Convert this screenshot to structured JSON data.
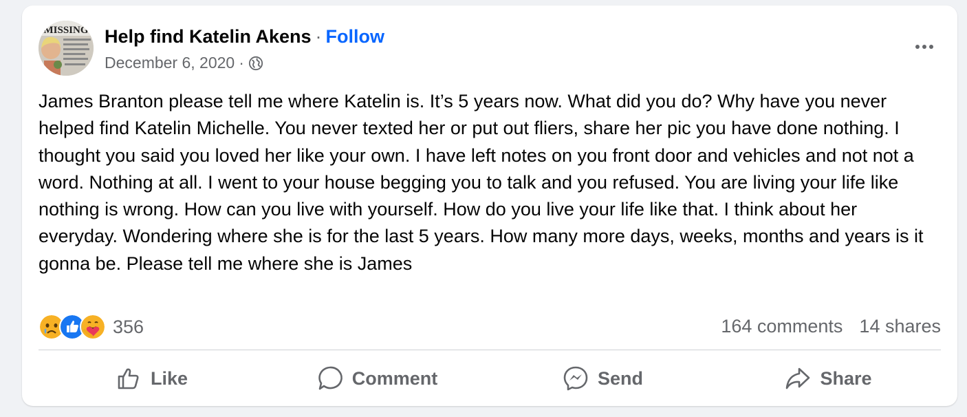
{
  "post": {
    "page_name": "Help find Katelin Akens",
    "separator": "·",
    "follow_label": "Follow",
    "date": "December 6, 2020",
    "privacy_icon": "globe-icon",
    "body": "James Branton please tell me where Katelin  is. It’s 5 years now. What did you do? Why have you never helped find Katelin Michelle. You never texted her or put out fliers, share her pic you have done nothing. I thought you said you loved her like your own. I have left notes on you front door and vehicles and not not a word. Nothing at all. I went to your house begging you to talk and you refused. You are living your life like nothing is wrong. How can you live with yourself. How do you live your life like that. I think about her everyday. Wondering where she is for the last 5 years. How many more days, weeks, months and years is it gonna be. Please tell me where she is James",
    "avatar_text": "MISSING"
  },
  "reactions": {
    "icons": [
      "sad-icon",
      "like-icon",
      "care-icon"
    ],
    "count": "356",
    "comments": "164 comments",
    "shares": "14 shares"
  },
  "actions": [
    {
      "label": "Like",
      "icon": "thumbs-up-icon"
    },
    {
      "label": "Comment",
      "icon": "comment-icon"
    },
    {
      "label": "Send",
      "icon": "messenger-icon"
    },
    {
      "label": "Share",
      "icon": "share-icon"
    }
  ],
  "colors": {
    "accent": "#0866ff",
    "secondary_text": "#65676b",
    "background": "#f0f2f5"
  }
}
